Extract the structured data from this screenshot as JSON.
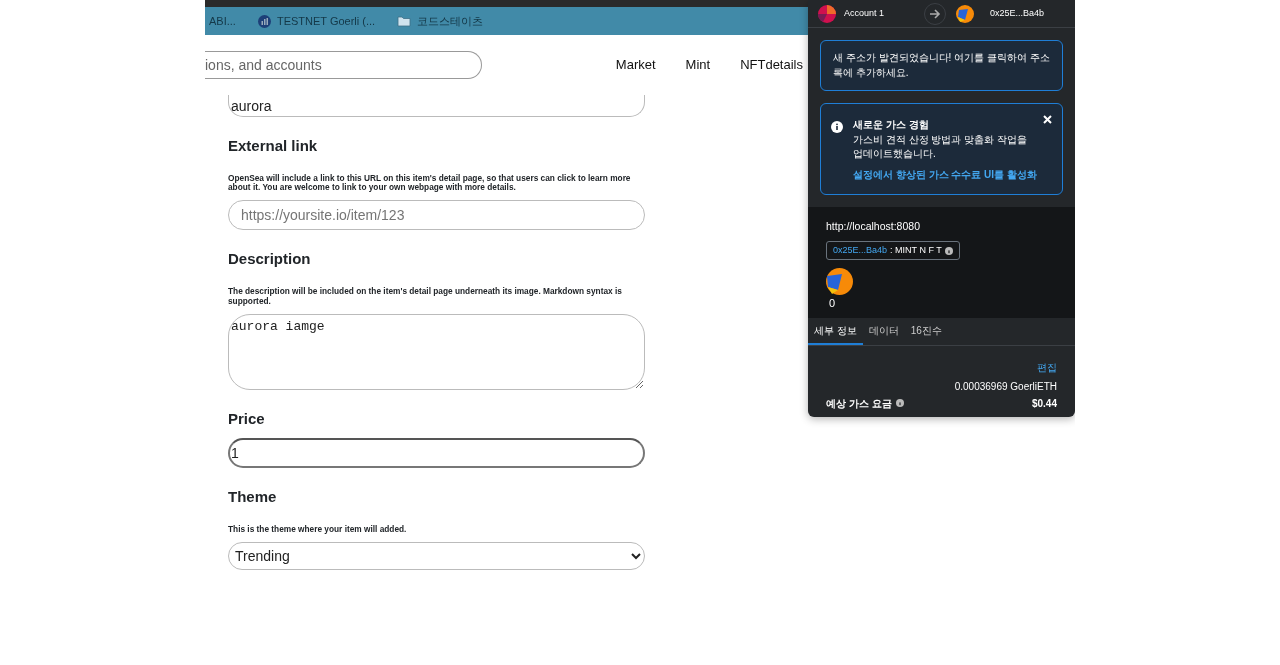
{
  "bookmarks": [
    {
      "kind": "plain",
      "label": "ABI..."
    },
    {
      "kind": "chart",
      "label": "TESTNET Goerli (..."
    },
    {
      "kind": "folder",
      "label": "코드스테이츠"
    }
  ],
  "header": {
    "search": {
      "placeholder": "ions, and accounts"
    },
    "nav": [
      "Market",
      "Mint",
      "NFTdetails"
    ]
  },
  "form": {
    "name_value": "aurora",
    "fields": [
      {
        "kind": "input",
        "label": "External link",
        "hint": "OpenSea will include a link to this URL on this item's detail page, so that users can click to learn more about it. You are welcome to link to your own webpage with more details.",
        "placeholder": "https://yoursite.io/item/123",
        "focused": false
      },
      {
        "kind": "textarea",
        "label": "Description",
        "hint": "The description will be included on the item's detail page underneath its image. Markdown syntax is supported.",
        "value": "aurora iamge",
        "focused": false
      },
      {
        "kind": "input",
        "label": "Price",
        "value": "1",
        "focused": true
      },
      {
        "kind": "select",
        "label": "Theme",
        "hint": "This is the theme where your item will added.",
        "value": "Trending",
        "focused": false
      }
    ]
  },
  "wallet": {
    "from": "Account 1",
    "to": "0x25E...Ba4b",
    "alerts": [
      {
        "kind": "notice",
        "text": "새 주소가 발견되었습니다! 여기를 클릭하여 주소록에 추가하세요."
      },
      {
        "kind": "info",
        "title": "새로운 가스 경험",
        "text": "가스비 견적 산정 방법과 맞춤화 작업을 업데이트했습니다.",
        "link": "설정에서 향상된 가스 수수료 UI를 활성화",
        "closable": true
      }
    ],
    "origin": "http://localhost:8080",
    "contract": {
      "address": "0x25E...Ba4b",
      "method": ": MINT N F T"
    },
    "amount": "0",
    "tabs": [
      {
        "label": "세부 정보",
        "selected": true
      },
      {
        "label": "데이터",
        "selected": false
      },
      {
        "label": "16진수",
        "selected": false
      }
    ],
    "edit": "편집",
    "gas": {
      "label": "예상 가스 요금",
      "amount": "0.00036969 GoerliETH",
      "fiat": "$0.44"
    }
  }
}
